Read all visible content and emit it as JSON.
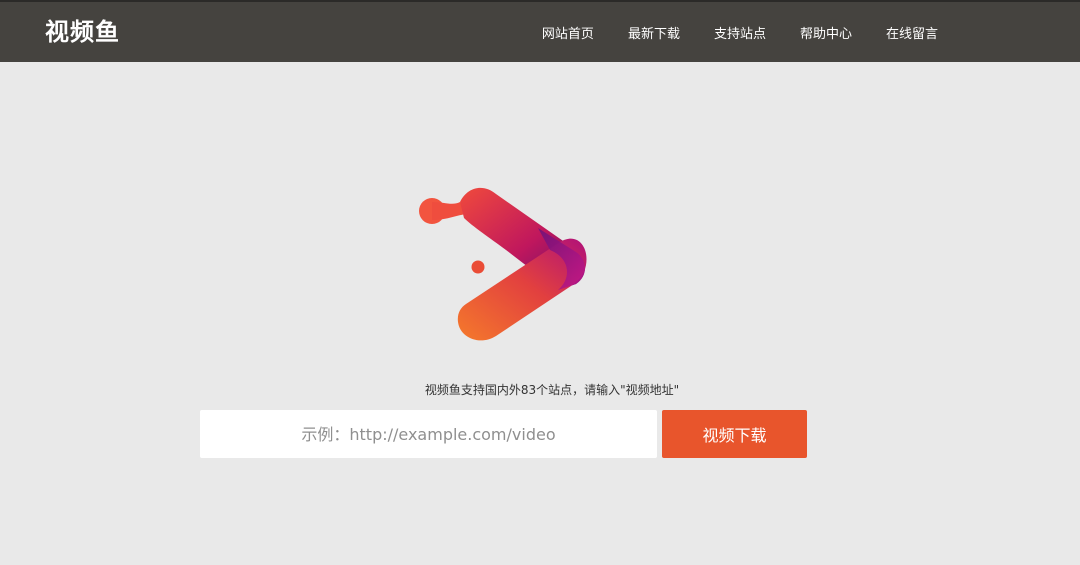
{
  "header": {
    "brand": "视频鱼",
    "nav": [
      {
        "label": "网站首页"
      },
      {
        "label": "最新下载"
      },
      {
        "label": "支持站点"
      },
      {
        "label": "帮助中心"
      },
      {
        "label": "在线留言"
      }
    ]
  },
  "hero": {
    "logo_icon": "play-arrow-icon",
    "tagline": "视频鱼支持国内外83个站点，请输入\"视频地址\""
  },
  "search": {
    "placeholder": "示例：http://example.com/video",
    "value": "",
    "button_label": "视频下载"
  },
  "colors": {
    "navbar": "#45433f",
    "background": "#e9e9e9",
    "accent": "#e8552c",
    "logo_orange": "#f26b2a",
    "logo_magenta": "#b0107a",
    "logo_purple": "#5b0f6e"
  }
}
